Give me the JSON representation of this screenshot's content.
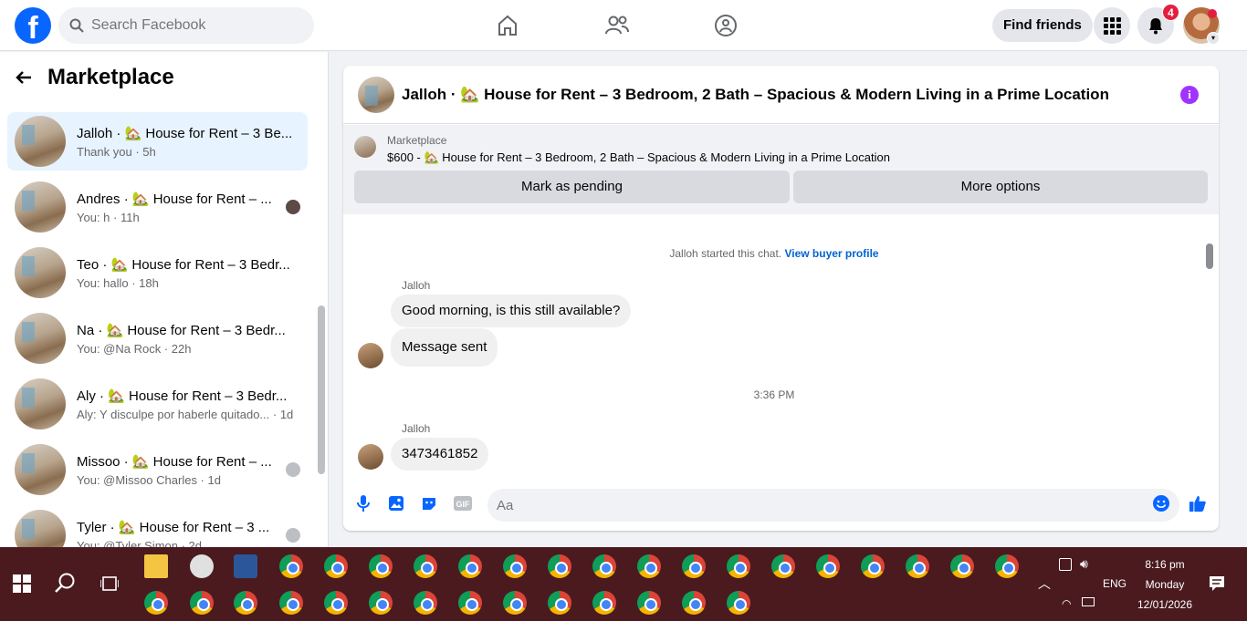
{
  "header": {
    "search_placeholder": "Search Facebook",
    "find_friends_label": "Find friends",
    "notification_count": "4"
  },
  "sidebar": {
    "title": "Marketplace",
    "conversations": [
      {
        "name": "Jalloh · 🏡 House for Rent – 3 Be...",
        "preview": "Thank you · 5h"
      },
      {
        "name": "Andres · 🏡 House for Rent – ...",
        "preview": "You: h · 11h"
      },
      {
        "name": "Teo · 🏡 House for Rent – 3 Bedr...",
        "preview": "You: hallo · 18h"
      },
      {
        "name": "Na · 🏡 House for Rent – 3 Bedr...",
        "preview": "You: @Na Rock · 22h"
      },
      {
        "name": "Aly · 🏡 House for Rent – 3 Bedr...",
        "preview": "Aly: Y disculpe por haberle quitado... · 1d"
      },
      {
        "name": "Missoo · 🏡 House for Rent – ...",
        "preview": "You: @Missoo Charles · 1d"
      },
      {
        "name": "Tyler · 🏡 House for Rent – 3 ...",
        "preview": "You: @Tyler Simon · 2d"
      }
    ]
  },
  "chat": {
    "title": "Jalloh · 🏡 House for Rent – 3 Bedroom, 2 Bath – Spacious & Modern Living in a Prime Location",
    "listing": {
      "source": "Marketplace",
      "title": "$600 - 🏡 House for Rent – 3 Bedroom, 2 Bath – Spacious & Modern Living in a Prime Location",
      "mark_pending_label": "Mark as pending",
      "more_options_label": "More options"
    },
    "system_text": "Jalloh started this chat.",
    "view_profile_label": "View buyer profile",
    "messages": [
      {
        "sender": "Jalloh",
        "text": "Good morning, is this still available?"
      },
      {
        "text": "Message sent"
      },
      {
        "time": "3:36 PM"
      },
      {
        "sender": "Jalloh",
        "text": "3473461852"
      }
    ],
    "composer_placeholder": "Aa"
  },
  "taskbar": {
    "time": "8:16 pm",
    "day": "Monday",
    "date": "12/01/2026",
    "language": "ENG"
  },
  "colors": {
    "facebook_blue": "#0866ff",
    "active_conversation": "#e7f3ff",
    "taskbar": "#4a1a1f"
  }
}
